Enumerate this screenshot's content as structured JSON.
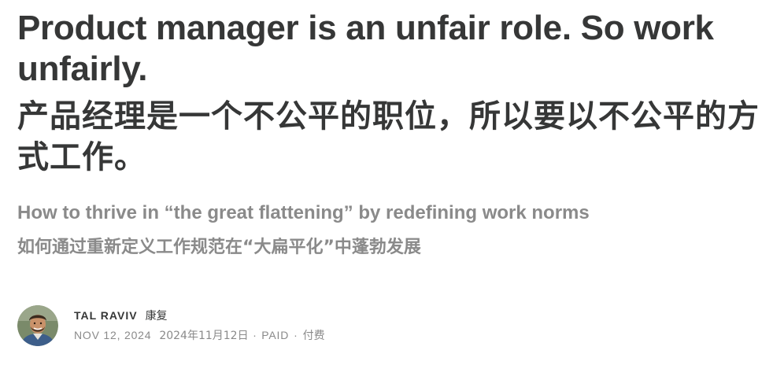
{
  "article": {
    "title_en": "Product manager is an unfair role. So work unfairly.",
    "title_zh": "产品经理是一个不公平的职位，所以要以不公平的方式工作。",
    "subtitle_en": "How to thrive in “the great flattening” by redefining work norms",
    "subtitle_zh": "如何通过重新定义工作规范在“大扁平化”中蓬勃发展"
  },
  "byline": {
    "avatar_icon": "author-avatar",
    "author_name": "TAL RAVIV",
    "author_name_zh": "康复",
    "date": "NOV 12, 2024",
    "date_zh": "2024年11月12日",
    "separator": "∙",
    "access": "PAID",
    "access_separator": "·",
    "access_zh": "付费"
  },
  "colors": {
    "text_primary": "#363737",
    "text_secondary": "#8a8a8a",
    "background": "#ffffff"
  }
}
